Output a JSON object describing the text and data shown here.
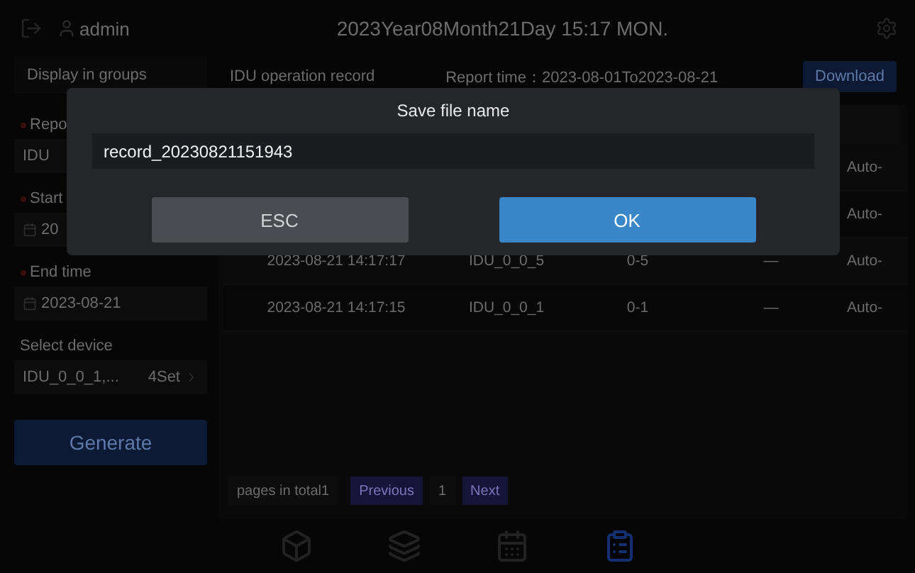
{
  "top_bar": {
    "user": "admin",
    "datetime": "2023Year08Month21Day 15:17 MON."
  },
  "sidebar": {
    "group_toggle": "Display in groups",
    "fields": [
      {
        "label": "Repo",
        "value": "IDU",
        "kind": "select",
        "required": true
      },
      {
        "label": "Start",
        "value": "20",
        "kind": "date",
        "required": true
      },
      {
        "label": "End time",
        "value": "2023-08-21",
        "kind": "date",
        "required": true
      },
      {
        "label": "Select device",
        "value": "IDU_0_0_1,...",
        "count": "4Set",
        "kind": "device",
        "required": false
      }
    ],
    "generate": "Generate"
  },
  "content": {
    "title": "IDU operation record",
    "report_time": "Report time：2023-08-01To2023-08-21",
    "download": "Download"
  },
  "table": {
    "rows": [
      {
        "column_5": "Auto-"
      },
      {
        "column_5": "Auto-"
      },
      {
        "column_1": "2023-08-21 14:17:17",
        "column_2": "IDU_0_0_5",
        "column_3": "0-5",
        "column_4": "—",
        "column_5": "Auto-"
      },
      {
        "column_1": "2023-08-21 14:17:15",
        "column_2": "IDU_0_0_1",
        "column_3": "0-1",
        "column_4": "—",
        "column_5": "Auto-"
      }
    ]
  },
  "pagination": {
    "total": "pages in total1",
    "previous": "Previous",
    "page": "1",
    "next": "Next"
  },
  "nav": [
    {
      "kind": "cube",
      "selected": false
    },
    {
      "kind": "list",
      "selected": false
    },
    {
      "kind": "calendar",
      "selected": false
    },
    {
      "kind": "clipboard",
      "selected": true
    }
  ],
  "dialog": {
    "title": "Save file name",
    "value": "record_20230821151943",
    "buttons": [
      {
        "label": "ESC",
        "kind": "cancel"
      },
      {
        "label": "OK",
        "kind": "confirm"
      }
    ]
  }
}
